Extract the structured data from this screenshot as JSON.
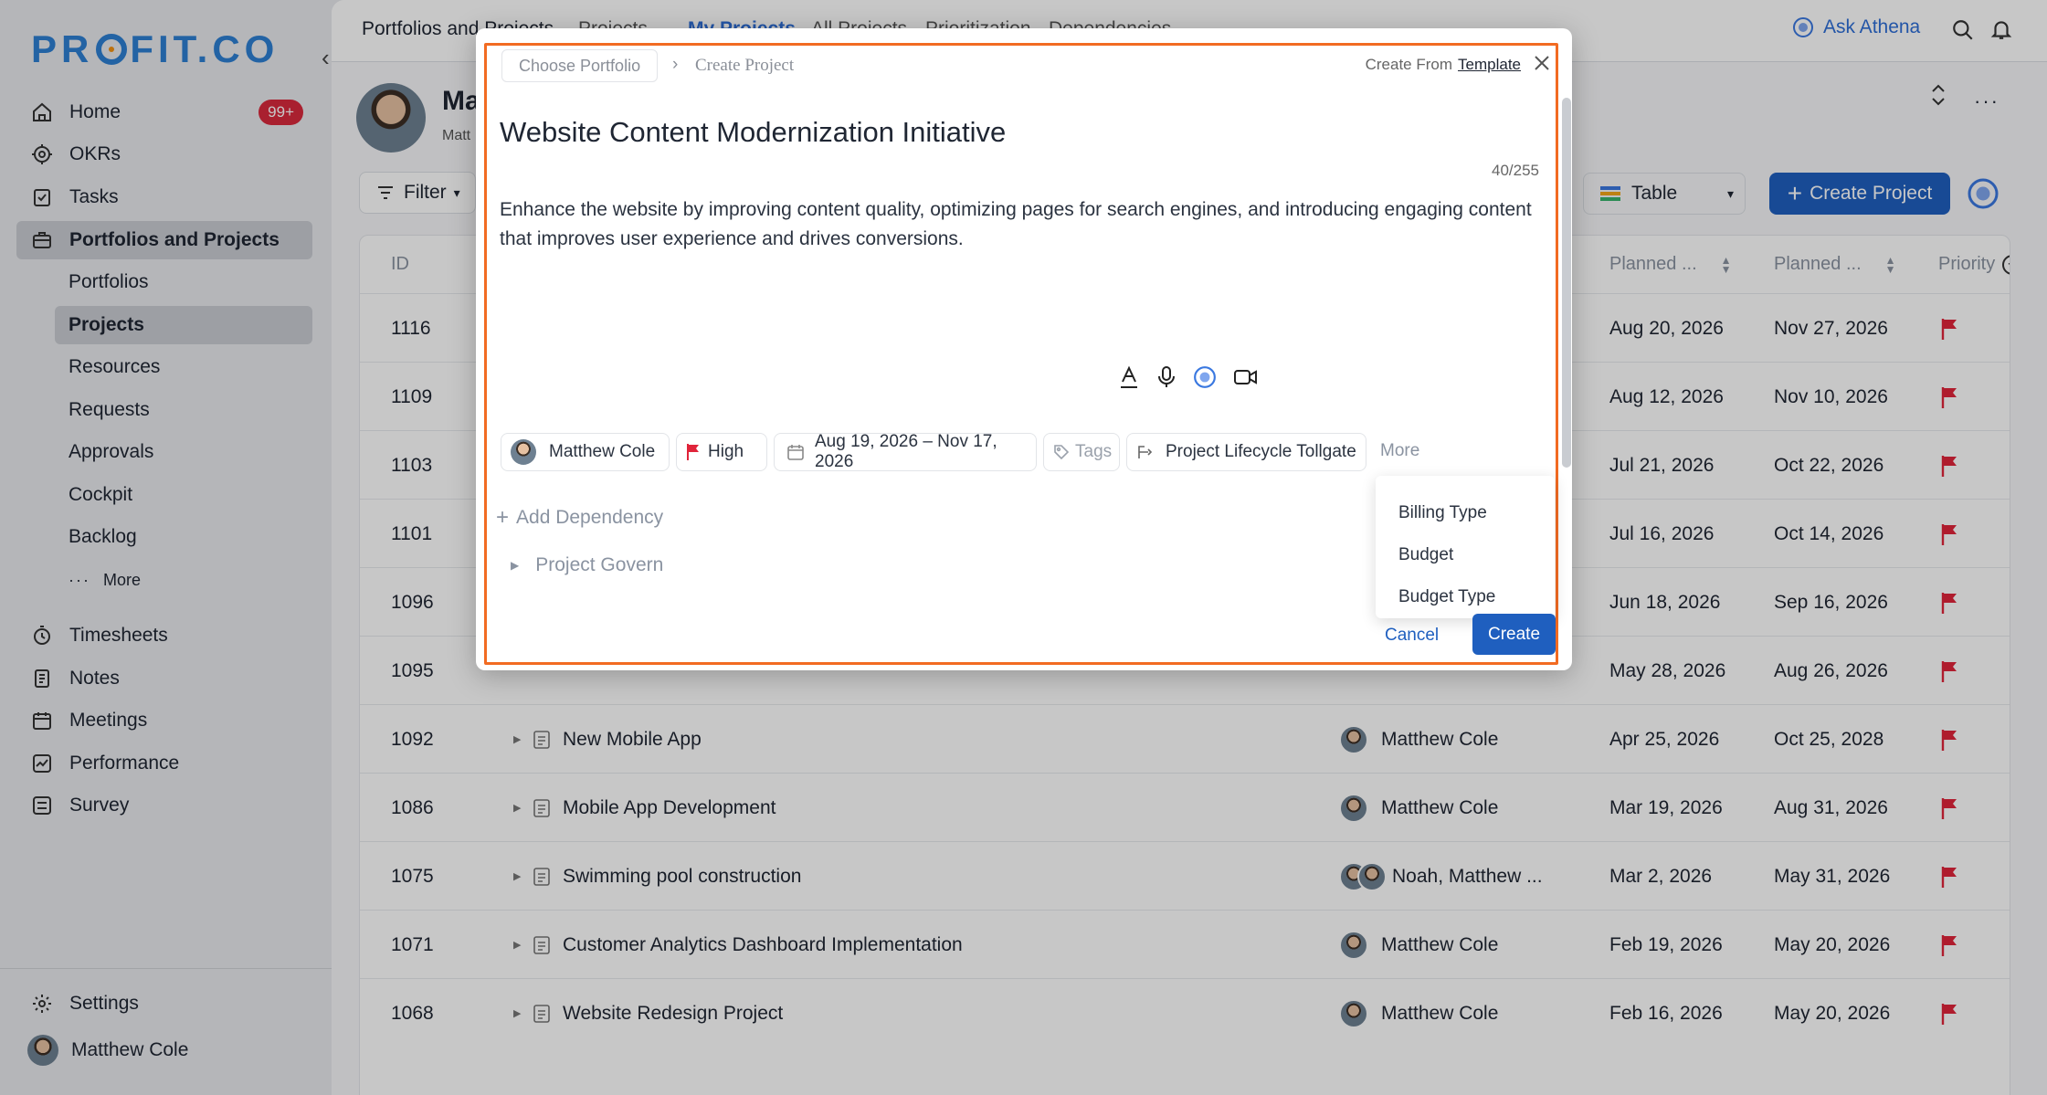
{
  "app": {
    "logo_text_1": "PR",
    "logo_text_2": "FIT.CO"
  },
  "sidebar": {
    "home": {
      "label": "Home",
      "badge": "99+"
    },
    "okrs": "OKRs",
    "tasks": "Tasks",
    "portfolios_projects": "Portfolios and Projects",
    "sub_items": [
      "Portfolios",
      "Projects",
      "Resources",
      "Requests",
      "Approvals",
      "Cockpit",
      "Backlog"
    ],
    "more": "More",
    "timesheets": "Timesheets",
    "notes": "Notes",
    "meetings": "Meetings",
    "performance": "Performance",
    "survey": "Survey",
    "settings": "Settings",
    "user_name": "Matthew Cole"
  },
  "header": {
    "tabs": [
      "Portfolios and Projects",
      "Projects",
      "My Projects",
      "All Projects",
      "Prioritization",
      "Dependencies"
    ],
    "ask_athena": "Ask Athena"
  },
  "page": {
    "user_initial": "Ma",
    "user_sub": "Matt",
    "filter_label": "Filter",
    "view_label": "Table",
    "create_project_label": "Create Project"
  },
  "table": {
    "headers": {
      "id": "ID",
      "planned_start": "Planned ...",
      "planned_end": "Planned ...",
      "priority": "Priority"
    },
    "rows": [
      {
        "id": "1116",
        "name": "",
        "owner": "",
        "start": "Aug 20, 2026",
        "end": "Nov 27, 2026"
      },
      {
        "id": "1109",
        "name": "",
        "owner": "",
        "start": "Aug 12, 2026",
        "end": "Nov 10, 2026"
      },
      {
        "id": "1103",
        "name": "",
        "owner": "",
        "start": "Jul 21, 2026",
        "end": "Oct 22, 2026"
      },
      {
        "id": "1101",
        "name": "",
        "owner": "",
        "start": "Jul 16, 2026",
        "end": "Oct 14, 2026"
      },
      {
        "id": "1096",
        "name": "",
        "owner": "",
        "start": "Jun 18, 2026",
        "end": "Sep 16, 2026"
      },
      {
        "id": "1095",
        "name": "",
        "owner": "",
        "start": "May 28, 2026",
        "end": "Aug 26, 2026"
      },
      {
        "id": "1092",
        "name": "New Mobile App",
        "owner": "Matthew Cole",
        "start": "Apr 25, 2026",
        "end": "Oct 25, 2028"
      },
      {
        "id": "1086",
        "name": "Mobile App Development",
        "owner": "Matthew Cole",
        "start": "Mar 19, 2026",
        "end": "Aug 31, 2026"
      },
      {
        "id": "1075",
        "name": "Swimming pool construction",
        "owner": "Noah, Matthew ...",
        "start": "Mar 2, 2026",
        "end": "May 31, 2026"
      },
      {
        "id": "1071",
        "name": "Customer Analytics Dashboard Implementation",
        "owner": "Matthew Cole",
        "start": "Feb 19, 2026",
        "end": "May 20, 2026"
      },
      {
        "id": "1068",
        "name": "Website Redesign Project",
        "owner": "Matthew Cole",
        "start": "Feb 16, 2026",
        "end": "May 20, 2026"
      }
    ]
  },
  "modal": {
    "breadcrumb_portfolio": "Choose Portfolio",
    "breadcrumb_current": "Create Project",
    "create_from": "Create From",
    "template_link": "Template",
    "title": "Website Content Modernization Initiative",
    "char_counter": "40/255",
    "description": "Enhance the website by improving content quality, optimizing pages for search engines, and introducing engaging content that improves user experience and drives conversions.",
    "owner": "Matthew Cole",
    "priority": "High",
    "date_range": "Aug 19, 2026 – Nov 17, 2026",
    "tags": "Tags",
    "lifecycle": "Project Lifecycle Tollgate",
    "more": "More",
    "more_options": [
      "Billing Type",
      "Budget",
      "Budget Type"
    ],
    "add_dependency": "Add Dependency",
    "project_govern": "Project Govern",
    "cancel": "Cancel",
    "create": "Create"
  },
  "colors": {
    "accent": "#1f5fbf",
    "flag": "#e0243a",
    "frame": "#f26b22",
    "badge": "#d9293d"
  }
}
